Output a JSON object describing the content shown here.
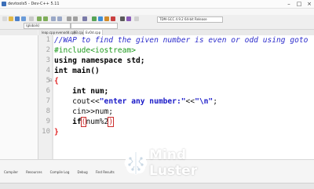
{
  "window": {
    "title": "devtools5 - Dev-C++ 5.11"
  },
  "menu": [
    "File",
    "Edit",
    "Search",
    "View",
    "Project",
    "Execute",
    "Tools",
    "AStyle",
    "Window",
    "Help"
  ],
  "toolbar": {
    "compiler": "TDM-GCC 4.9.2 64-bit Release",
    "globals": "(globals)"
  },
  "left_panel": {
    "tabs": [
      "Project",
      "Classes",
      "Debug"
    ]
  },
  "file_tabs": [
    "leap.cpp",
    "evenodd.cpp",
    "P3.cpp",
    "EvOd.cpp"
  ],
  "editor": {
    "lines": [
      {
        "n": "1",
        "text": "//WAP to find the given number is even or odd using goto"
      },
      {
        "n": "2",
        "text": "#include<iostream>"
      },
      {
        "n": "3",
        "text": "using namespace std;"
      },
      {
        "n": "4",
        "text": "int main()"
      },
      {
        "n": "5",
        "text": "{"
      },
      {
        "n": "6",
        "text": "    int num;"
      },
      {
        "n": "7a",
        "text": "    cout<<"
      },
      {
        "n": "7b",
        "text": "\"enter any number:\""
      },
      {
        "n": "7c",
        "text": "<<"
      },
      {
        "n": "7d",
        "text": "\"\\n\""
      },
      {
        "n": "7e",
        "text": ";"
      },
      {
        "n": "8",
        "text": "    cin>>num;"
      },
      {
        "n": "9a",
        "text": "    if"
      },
      {
        "n": "9b",
        "text": "("
      },
      {
        "n": "9c",
        "text": "num%2"
      },
      {
        "n": "9d",
        "text": ")"
      },
      {
        "n": "10",
        "text": "}"
      }
    ],
    "numbers": [
      "1",
      "2",
      "3",
      "4",
      "5",
      "6",
      "7",
      "8",
      "9",
      "10"
    ]
  },
  "bottom_panel": {
    "tabs": [
      "Compiler",
      "Resources",
      "Compile Log",
      "Debug",
      "Find Results"
    ]
  },
  "logo": {
    "word1": "Mind",
    "word2": "Luster"
  },
  "colors": {
    "comment": "#2d2dcc",
    "preprocessor": "#1e9a1e",
    "string": "#1919c8",
    "bracket": "#e02020"
  }
}
